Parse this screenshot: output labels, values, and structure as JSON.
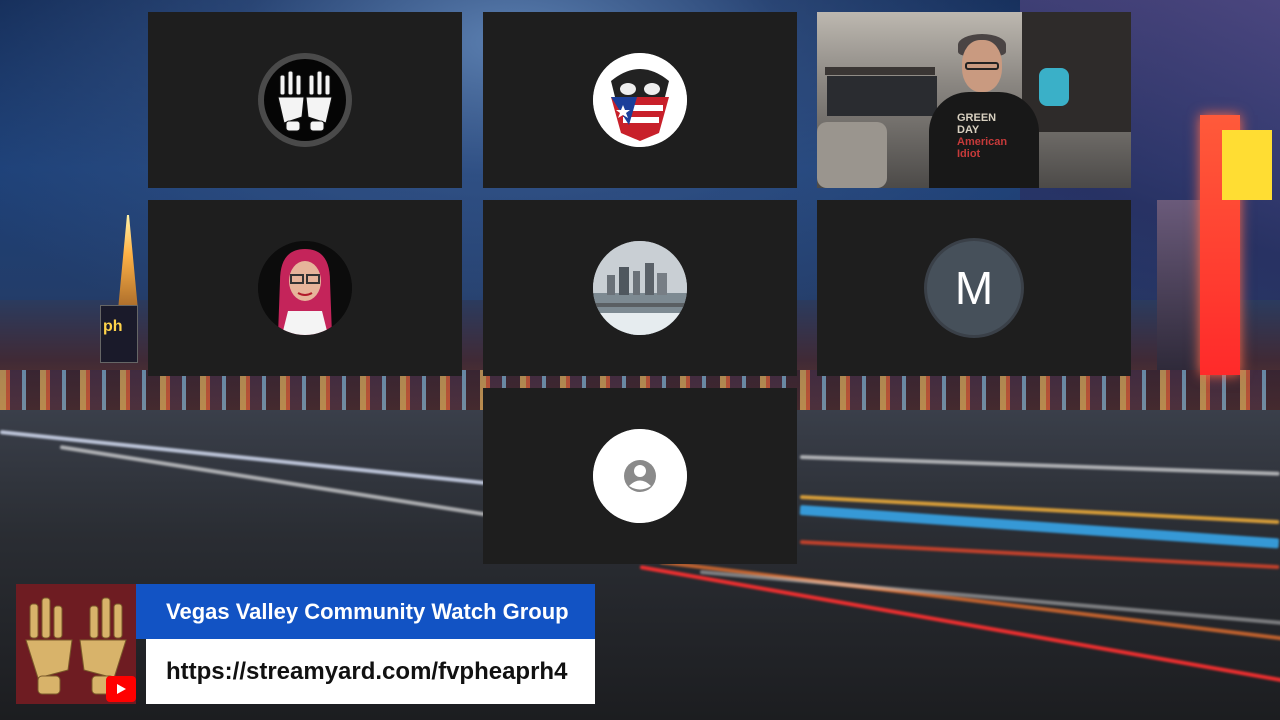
{
  "colors": {
    "tile_background": "#1e1e1e",
    "title_bar": "#1253c4",
    "url_bar": "#ffffff",
    "logo_box": "#6e1c22",
    "initial_avatar": "#46505a"
  },
  "participants": [
    {
      "id": "skeleton-hands-logo",
      "avatar_type": "image",
      "icon": "skeleton-hands-icon"
    },
    {
      "id": "puerto-rico-skull",
      "avatar_type": "image",
      "icon": "skull-flag-icon"
    },
    {
      "id": "camera-host",
      "avatar_type": "video",
      "shirt_text": [
        "GREEN",
        "DAY",
        "American",
        "Idiot"
      ]
    },
    {
      "id": "red-hair-woman",
      "avatar_type": "image",
      "icon": "person-photo-icon"
    },
    {
      "id": "city-skyline",
      "avatar_type": "image",
      "icon": "city-photo-icon"
    },
    {
      "id": "initial-m",
      "avatar_type": "initial",
      "initial": "M"
    },
    {
      "id": "default-user",
      "avatar_type": "placeholder",
      "icon": "account-circle-icon"
    }
  ],
  "background_signs": {
    "casino_sign": "ph"
  },
  "lower_third": {
    "title": "Vegas Valley Community Watch Group",
    "url": "https://streamyard.com/fvpheaprh4",
    "logo_icon": "skeleton-hands-icon",
    "platform_icon": "youtube-icon"
  }
}
